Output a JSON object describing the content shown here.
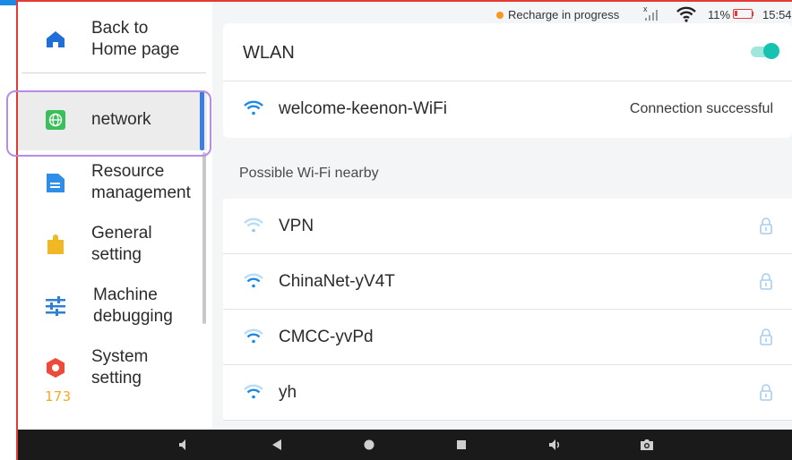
{
  "sidebar": {
    "items": [
      {
        "label": "Back to\nHome page",
        "icon": "home-icon"
      },
      {
        "label": "network",
        "icon": "globe-icon",
        "active": true
      },
      {
        "label": "Resource\nmanagement",
        "icon": "folder-icon"
      },
      {
        "label": "General\nsetting",
        "icon": "puzzle-icon"
      },
      {
        "label": "Machine\ndebugging",
        "icon": "sliders-icon"
      },
      {
        "label": "System\nsetting",
        "icon": "hexagon-icon"
      }
    ],
    "bottom_digits": "173"
  },
  "status_bar": {
    "charging_text": "Recharge in progress",
    "signal_label": "x",
    "battery_percent": "11%",
    "time": "15:54"
  },
  "wlan": {
    "title": "WLAN",
    "enabled": true,
    "connected": {
      "ssid": "welcome-keenon-WiFi",
      "status": "Connection successful"
    }
  },
  "nearby": {
    "title": "Possible Wi-Fi nearby",
    "networks": [
      {
        "ssid": "VPN",
        "locked": true
      },
      {
        "ssid": "ChinaNet-yV4T",
        "locked": true
      },
      {
        "ssid": "CMCC-yvPd",
        "locked": true
      },
      {
        "ssid": "yh",
        "locked": true
      }
    ]
  },
  "colors": {
    "accent_blue": "#3b7de0",
    "wifi_blue": "#1e88e5",
    "toggle_teal": "#16c2b0",
    "charging_orange": "#f59a1e",
    "battery_red": "#e53935",
    "highlight_purple": "#b98ae6"
  }
}
